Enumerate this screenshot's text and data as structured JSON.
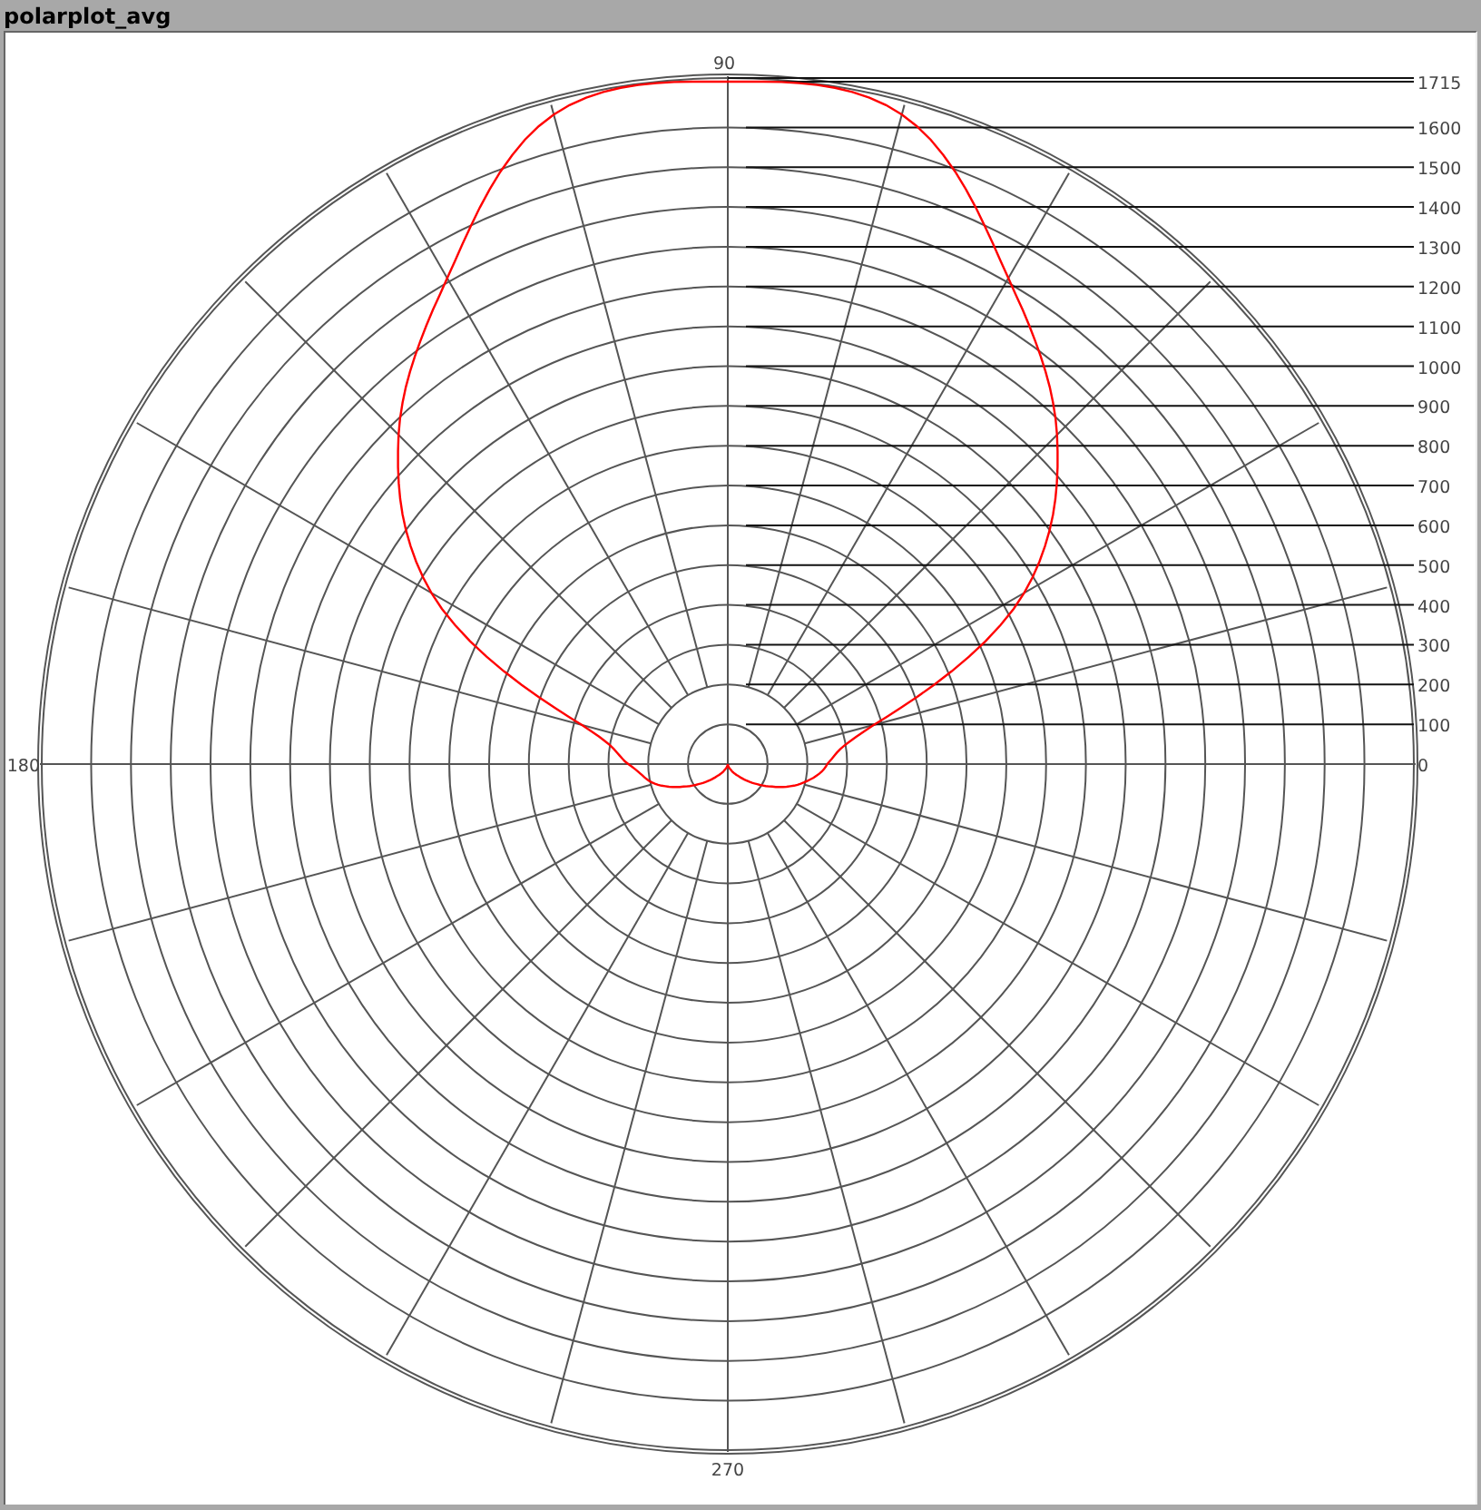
{
  "window": {
    "title": "polarplot_avg"
  },
  "plot": {
    "angle_labels": [
      "0",
      "90",
      "180",
      "270"
    ],
    "radial_labels": [
      "1715",
      "1600",
      "1500",
      "1400",
      "1300",
      "1200",
      "1100",
      "1000",
      "900",
      "800",
      "700",
      "600",
      "500",
      "400",
      "300",
      "200",
      "100"
    ]
  }
}
